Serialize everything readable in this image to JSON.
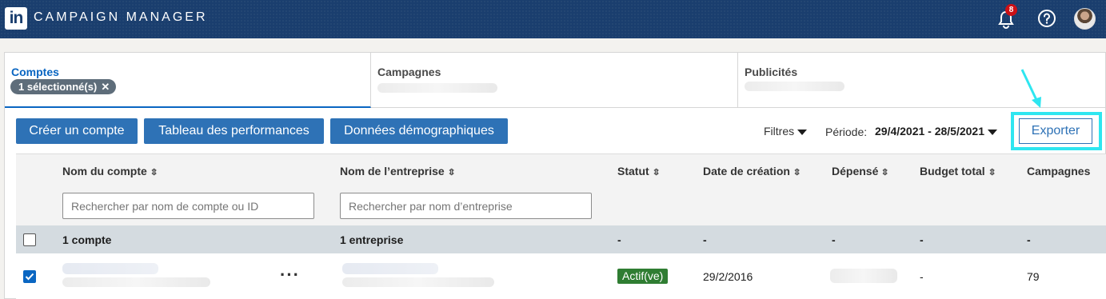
{
  "app": {
    "logo_text": "in",
    "title": "CAMPAIGN MANAGER",
    "notifications_count": "8"
  },
  "tabs": [
    {
      "label": "Comptes",
      "chip": "1 sélectionné(s)",
      "active": true
    },
    {
      "label": "Campagnes",
      "active": false
    },
    {
      "label": "Publicités",
      "active": false
    }
  ],
  "toolbar": {
    "create_account": "Créer un compte",
    "performance_table": "Tableau des performances",
    "demographics": "Données démographiques",
    "filters": "Filtres",
    "period_label": "Période:",
    "period_value": "29/4/2021 - 28/5/2021",
    "export": "Exporter"
  },
  "table": {
    "columns": [
      "Nom du compte",
      "Nom de l’entreprise",
      "Statut",
      "Date de création",
      "Dépensé",
      "Budget total",
      "Campagnes"
    ],
    "search_account_placeholder": "Rechercher par nom de compte ou ID",
    "search_company_placeholder": "Rechercher par nom d’entreprise",
    "summary": {
      "account": "1 compte",
      "company": "1 entreprise",
      "status": "-",
      "created": "-",
      "spent": "-",
      "budget": "-",
      "campaigns": "-"
    },
    "rows": [
      {
        "checked": true,
        "more": "···",
        "status": "Actif(ve)",
        "created": "29/2/2016",
        "budget": "-",
        "campaigns": "79"
      }
    ]
  },
  "colors": {
    "header_bg": "#1a3e6e",
    "primary": "#2e72b6",
    "highlight": "#2ee6f0",
    "status_active": "#2f7d32"
  }
}
